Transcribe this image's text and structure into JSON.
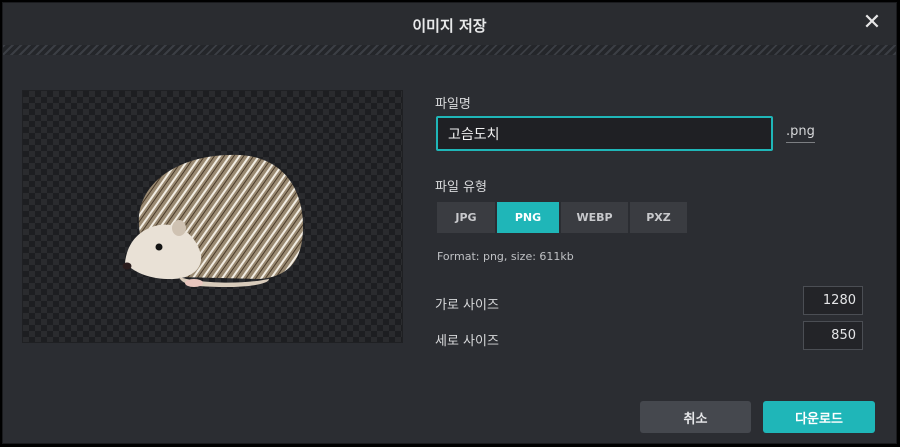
{
  "dialog": {
    "title": "이미지 저장",
    "close_icon": "close-icon"
  },
  "form": {
    "filename_label": "파일명",
    "filename_value": "고슴도치",
    "extension": ".png",
    "filetype_label": "파일 유형",
    "types": [
      {
        "label": "JPG",
        "active": false
      },
      {
        "label": "PNG",
        "active": true
      },
      {
        "label": "WEBP",
        "active": false
      },
      {
        "label": "PXZ",
        "active": false
      }
    ],
    "info": "Format: png, size: 611kb",
    "width_label": "가로 사이즈",
    "width_value": "1280",
    "height_label": "세로 사이즈",
    "height_value": "850"
  },
  "buttons": {
    "cancel": "취소",
    "download": "다운로드"
  },
  "colors": {
    "accent": "#1fb6b8",
    "background": "#2b2d32"
  }
}
